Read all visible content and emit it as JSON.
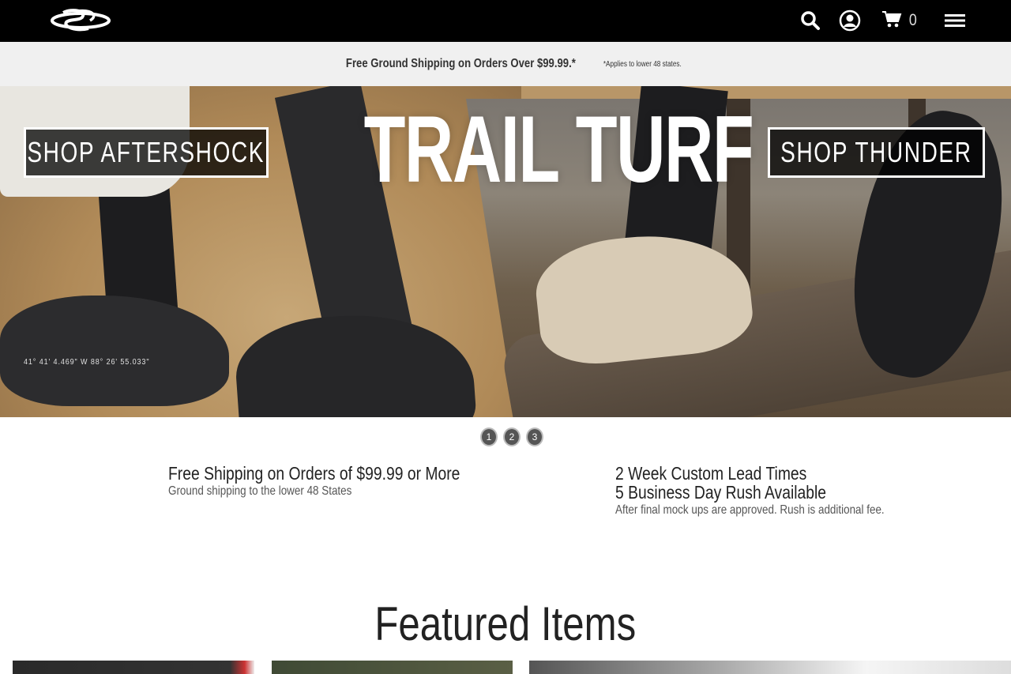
{
  "header": {
    "logo_icon": "boombah-logo-icon",
    "icons": [
      "search-icon",
      "account-icon",
      "cart-icon",
      "menu-icon"
    ],
    "cart_count": "0"
  },
  "promo": {
    "main": "Free Ground Shipping on Orders Over $99.99.*",
    "note": "*Applies to lower 48 states."
  },
  "hero": {
    "title": "TRAIL TURF",
    "left_button": "SHOP AFTERSHOCK",
    "right_button": "SHOP THUNDER",
    "coordinates": "41° 41' 4.469\" W 88° 26' 55.033\""
  },
  "slider": {
    "dots": [
      "1",
      "2",
      "3"
    ]
  },
  "info": {
    "left_heading": "Free Shipping on Orders of $99.99 or More",
    "left_sub": "Ground shipping to the lower 48 States",
    "right_heading_1": "2 Week Custom Lead Times",
    "right_heading_2": "5 Business Day Rush Available",
    "right_sub": "After final mock ups are approved. Rush is additional fee."
  },
  "featured": {
    "title": "Featured Items"
  },
  "colors": {
    "topbar": "#000000",
    "promo_bg": "#f0f0f0"
  }
}
